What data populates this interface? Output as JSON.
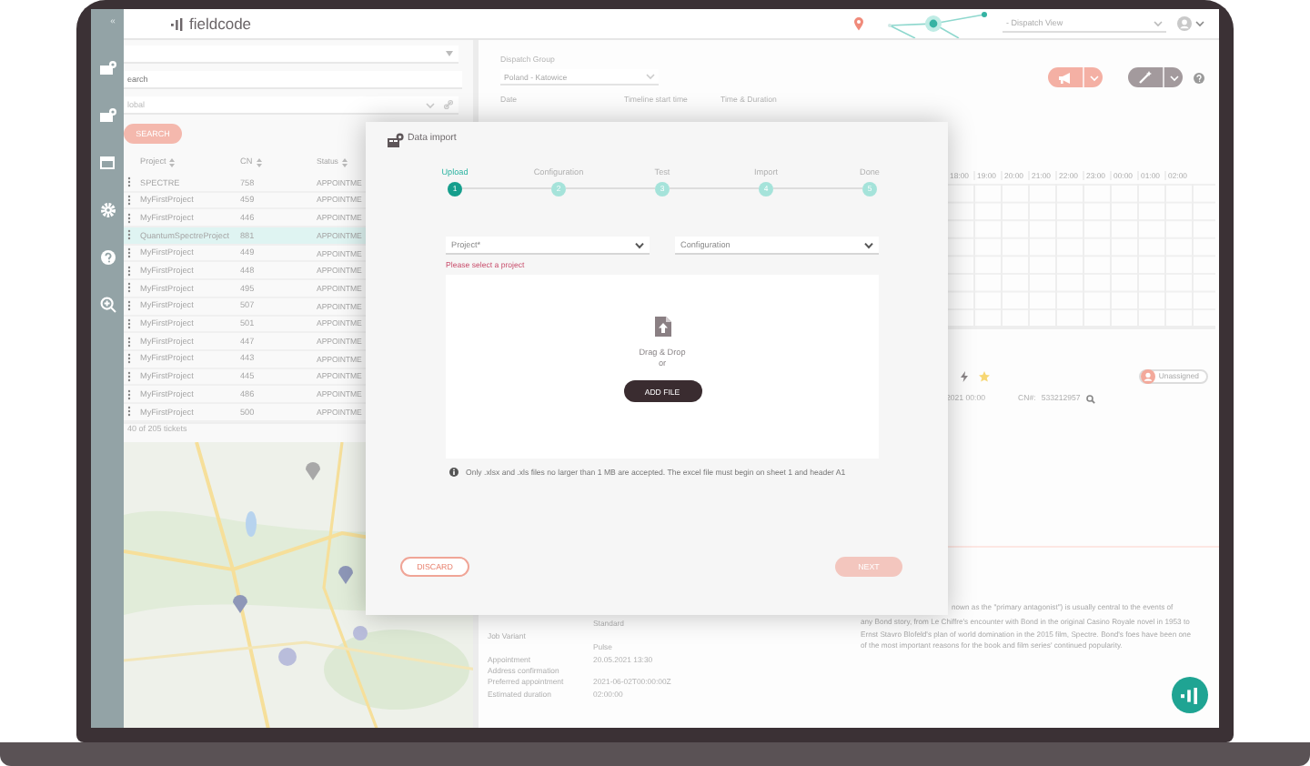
{
  "sidebar": {
    "collapse": "«"
  },
  "header": {
    "logo": "fieldcode",
    "view_select": "- Dispatch View"
  },
  "ticket_list": {
    "search": {
      "placeholder": "earch"
    },
    "scope": "lobal",
    "search_button": "SEARCH",
    "columns": [
      "Project",
      "CN",
      "Status"
    ],
    "rows": [
      {
        "project": "SPECTRE",
        "cn": "758",
        "status": "APPOINTME",
        "selected": false
      },
      {
        "project": "MyFirstProject",
        "cn": "459",
        "status": "APPOINTME",
        "selected": false
      },
      {
        "project": "MyFirstProject",
        "cn": "446",
        "status": "APPOINTME",
        "selected": false
      },
      {
        "project": "QuantumSpectreProject",
        "cn": "881",
        "status": "APPOINTME",
        "selected": true
      },
      {
        "project": "MyFirstProject",
        "cn": "449",
        "status": "APPOINTME",
        "selected": false
      },
      {
        "project": "MyFirstProject",
        "cn": "448",
        "status": "APPOINTME",
        "selected": false
      },
      {
        "project": "MyFirstProject",
        "cn": "495",
        "status": "APPOINTME",
        "selected": false
      },
      {
        "project": "MyFirstProject",
        "cn": "507",
        "status": "APPOINTME",
        "selected": false
      },
      {
        "project": "MyFirstProject",
        "cn": "501",
        "status": "APPOINTME",
        "selected": false
      },
      {
        "project": "MyFirstProject",
        "cn": "447",
        "status": "APPOINTME",
        "selected": false
      },
      {
        "project": "MyFirstProject",
        "cn": "443",
        "status": "APPOINTME",
        "selected": false
      },
      {
        "project": "MyFirstProject",
        "cn": "445",
        "status": "APPOINTME",
        "selected": false
      },
      {
        "project": "MyFirstProject",
        "cn": "486",
        "status": "APPOINTME",
        "selected": false
      },
      {
        "project": "MyFirstProject",
        "cn": "500",
        "status": "APPOINTME",
        "selected": false
      }
    ],
    "footer": "40 of 205 tickets"
  },
  "dispatch": {
    "group_label": "Dispatch Group",
    "group_value": "Poland - Katowice",
    "labels": [
      "Date",
      "Timeline start time",
      "Time & Duration"
    ],
    "hours": [
      "18:00",
      "19:00",
      "20:00",
      "21:00",
      "22:00",
      "23:00",
      "00:00",
      "01:00",
      "02:00"
    ]
  },
  "ticket": {
    "assignee": "Unassigned",
    "date": "2021 00:00",
    "cn_label": "CN#:",
    "cn": "533212957",
    "details": [
      {
        "value": "Standard"
      },
      {
        "label": "Job Variant"
      },
      {
        "value": "Pulse"
      },
      {
        "label": "Appointment",
        "value": "20.05.2021 13:30"
      },
      {
        "label": "Address confirmation"
      },
      {
        "label": "Preferred appointment",
        "value": "2021-06-02T00:00:00Z"
      },
      {
        "label": "Estimated duration",
        "value": "02:00:00"
      }
    ],
    "description_fragment": "nown as the \"primary antagonist\") is usually central to the events of",
    "description": "any Bond story, from Le Chiffre's encounter with Bond in the original Casino Royale novel in 1953 to Ernst Stavro Blofeld's plan of world domination in the 2015 film, Spectre. Bond's foes have been one of the most important reasons for the book and film series' continued popularity."
  },
  "modal": {
    "title": "Data import",
    "steps": [
      {
        "label": "Upload",
        "number": "1",
        "selected": true
      },
      {
        "label": "Configuration",
        "number": "2",
        "selected": false
      },
      {
        "label": "Test",
        "number": "3",
        "selected": false
      },
      {
        "label": "Import",
        "number": "4",
        "selected": false
      },
      {
        "label": "Done",
        "number": "5",
        "selected": false
      }
    ],
    "project_select": {
      "placeholder": "Project*"
    },
    "config_select": {
      "placeholder": "Configuration"
    },
    "error": "Please select a project",
    "drop_text": "Drag & Drop",
    "or": "or",
    "add_file": "ADD FILE",
    "info": "Only .xlsx and .xls files no larger than 1 MB are accepted. The excel file must begin on sheet 1 and header A1",
    "discard": "DISCARD",
    "next": {
      "label": "NEXT",
      "disabled": true
    }
  }
}
